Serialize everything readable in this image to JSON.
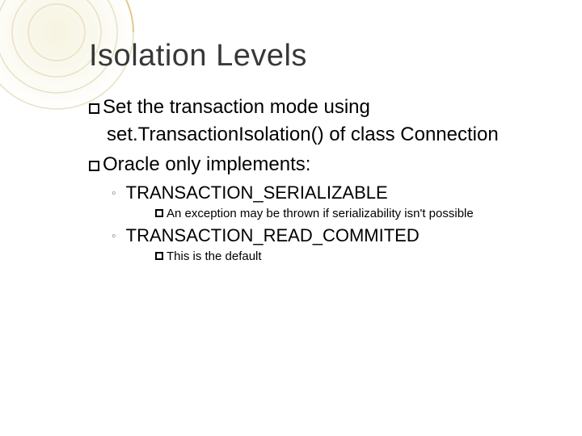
{
  "slide": {
    "title": "Isolation Levels",
    "bullet1_part1": "Set the transaction mode using",
    "bullet1_part2": "set.TransactionIsolation() of class Connection",
    "bullet2": "Oracle only implements:",
    "sub1": "TRANSACTION_SERIALIZABLE",
    "sub1_note": "An exception may be thrown if serializability isn't possible",
    "sub2": "TRANSACTION_READ_COMMITED",
    "sub2_note": "This is the default"
  }
}
